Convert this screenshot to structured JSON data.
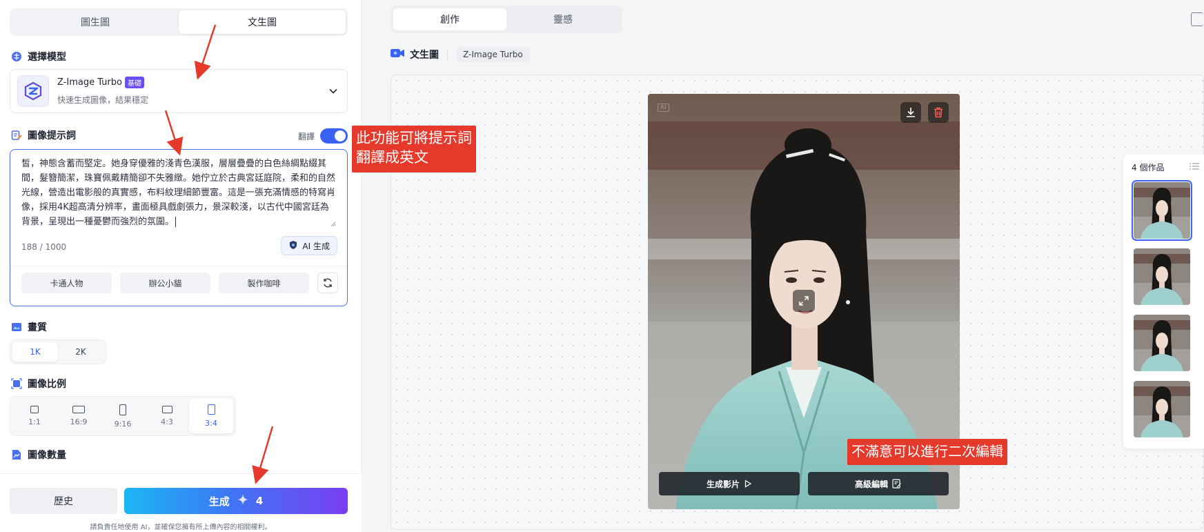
{
  "left_panel": {
    "mode_tabs": [
      {
        "label": "圖生圖",
        "active": false
      },
      {
        "label": "文生圖",
        "active": true
      }
    ],
    "model_section": {
      "title": "選擇模型",
      "model_name": "Z-Image Turbo",
      "model_badge": "基礎",
      "model_desc": "快速生成圖像，結果穩定"
    },
    "prompt_section": {
      "title": "圖像提示詞",
      "translate_label": "翻譯",
      "translate_on": true,
      "text": "皙，神態含蓄而堅定。她身穿優雅的淺青色漢服，層層疊疊的白色絲綢點綴其間，髮簪簡潔，珠寶佩戴精簡卻不失雅緻。她佇立於古典宮廷庭院，柔和的自然光線，營造出電影般的真實感，布料紋理細節豐富。這是一張充滿情感的特寫肖像，採用4K超高清分辨率，畫面極具戲劇張力，景深較淺，以古代中國宮廷為背景，呈現出一種憂鬱而強烈的氛圍。",
      "char_count": "188 / 1000",
      "ai_button": "AI 生成",
      "suggestions": [
        "卡通人物",
        "辦公小貓",
        "製作咖啡"
      ]
    },
    "quality_section": {
      "title": "畫質",
      "options": [
        "1K",
        "2K"
      ],
      "selected": "1K"
    },
    "ratio_section": {
      "title": "圖像比例",
      "options": [
        "1:1",
        "16:9",
        "9:16",
        "4:3",
        "3:4"
      ],
      "selected": "3:4"
    },
    "count_section": {
      "title": "圖像數量"
    },
    "bottom": {
      "history_label": "歷史",
      "generate_label": "生成",
      "generate_cost": "4",
      "disclaimer": "請負責任地使用 AI，並確保您擁有所上傳內容的相關權利。"
    }
  },
  "right_area": {
    "tabs": [
      {
        "label": "創作",
        "active": true
      },
      {
        "label": "靈感",
        "active": false
      }
    ],
    "header_title": "文生圖",
    "header_model": "Z-Image Turbo",
    "preview": {
      "ai_mark": "AI",
      "video_button": "生成影片",
      "edit_button": "高級編輯"
    },
    "works": {
      "title": "4 個作品",
      "count": 4,
      "selected_index": 0
    }
  },
  "annotations": {
    "translate_note": "此功能可將提示詞翻譯成英文",
    "edit_note": "不滿意可以進行二次編輯"
  },
  "colors": {
    "accent": "#3b62f6",
    "annotation": "#e4392b",
    "gradient_start": "#1bb7f5",
    "gradient_end": "#7a3df2"
  }
}
